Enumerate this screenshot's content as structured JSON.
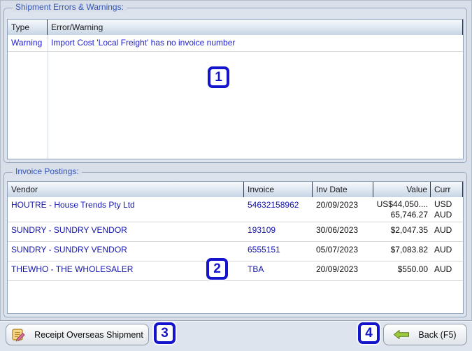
{
  "colors": {
    "window_bg": "#d8dfe8",
    "group_label_blue": "#3355bb",
    "error_text_blue": "#2222cc",
    "link_blue": "#1515ad",
    "marker_blue": "#1414cc",
    "back_arrow_green": "#8fbc2e"
  },
  "errors_panel": {
    "title": "Shipment Errors & Warnings:",
    "columns": {
      "type": "Type",
      "message": "Error/Warning"
    },
    "rows": [
      {
        "type": "Warning",
        "message": "Import Cost 'Local Freight' has no invoice number"
      }
    ]
  },
  "postings_panel": {
    "title": "Invoice Postings:",
    "columns": {
      "vendor": "Vendor",
      "invoice": "Invoice",
      "inv_date": "Inv Date",
      "value": "Value",
      "curr": "Curr"
    },
    "rows": [
      {
        "vendor": "HOUTRE - House Trends Pty Ltd",
        "invoice": "54632158962",
        "inv_date": "20/09/2023",
        "value": "US$44,050....",
        "value2": "65,746.27",
        "curr": "USD",
        "curr2": "AUD"
      },
      {
        "vendor": "SUNDRY - SUNDRY VENDOR",
        "invoice": "193109",
        "inv_date": "30/06/2023",
        "value": "$2,047.35",
        "curr": "AUD"
      },
      {
        "vendor": "SUNDRY - SUNDRY VENDOR",
        "invoice": "6555151",
        "inv_date": "05/07/2023",
        "value": "$7,083.82",
        "curr": "AUD"
      },
      {
        "vendor": "THEWHO - THE WHOLESALER",
        "invoice": "TBA",
        "inv_date": "20/09/2023",
        "value": "$550.00",
        "curr": "AUD"
      }
    ]
  },
  "footer": {
    "receipt_button_label": "Receipt Overseas Shipment",
    "back_button_label": "Back (F5)"
  },
  "annotations": {
    "m1": "1",
    "m2": "2",
    "m3": "3",
    "m4": "4"
  }
}
